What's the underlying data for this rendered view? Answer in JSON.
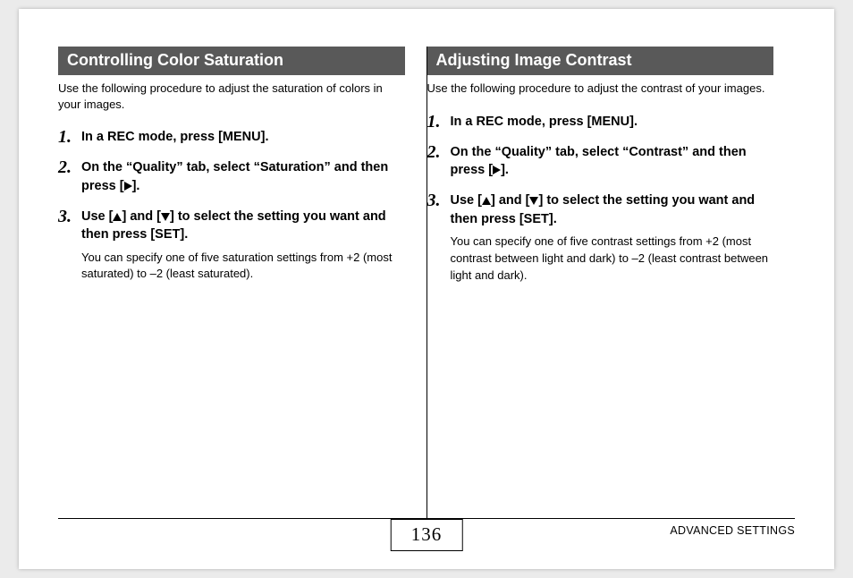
{
  "left": {
    "heading": "Controlling Color Saturation",
    "intro": "Use the following procedure to adjust the saturation of colors in your images.",
    "steps": [
      {
        "num": "1.",
        "main_a": "In a REC mode, press [MENU]."
      },
      {
        "num": "2.",
        "main_a": "On the “Quality” tab, select “Saturation” and then press [",
        "icon": "right",
        "main_b": "]."
      },
      {
        "num": "3.",
        "main_a": "Use [",
        "icon1": "up",
        "mid": "] and [",
        "icon2": "down",
        "main_b": "] to select the setting you want and then press [SET].",
        "sub": "You can specify one of five saturation settings from +2 (most saturated) to –2 (least saturated)."
      }
    ]
  },
  "right": {
    "heading": "Adjusting Image Contrast",
    "intro": "Use the following procedure to adjust the contrast of your images.",
    "steps": [
      {
        "num": "1.",
        "main_a": "In a REC mode, press [MENU]."
      },
      {
        "num": "2.",
        "main_a": "On the “Quality” tab, select “Contrast” and then press [",
        "icon": "right",
        "main_b": "]."
      },
      {
        "num": "3.",
        "main_a": "Use [",
        "icon1": "up",
        "mid": "] and [",
        "icon2": "down",
        "main_b": "] to select the setting you want and then press [SET].",
        "sub": "You can specify one of five contrast settings from +2 (most contrast between light and dark) to –2 (least contrast between light and dark)."
      }
    ]
  },
  "footer": {
    "page_number": "136",
    "section_label": "ADVANCED SETTINGS"
  }
}
